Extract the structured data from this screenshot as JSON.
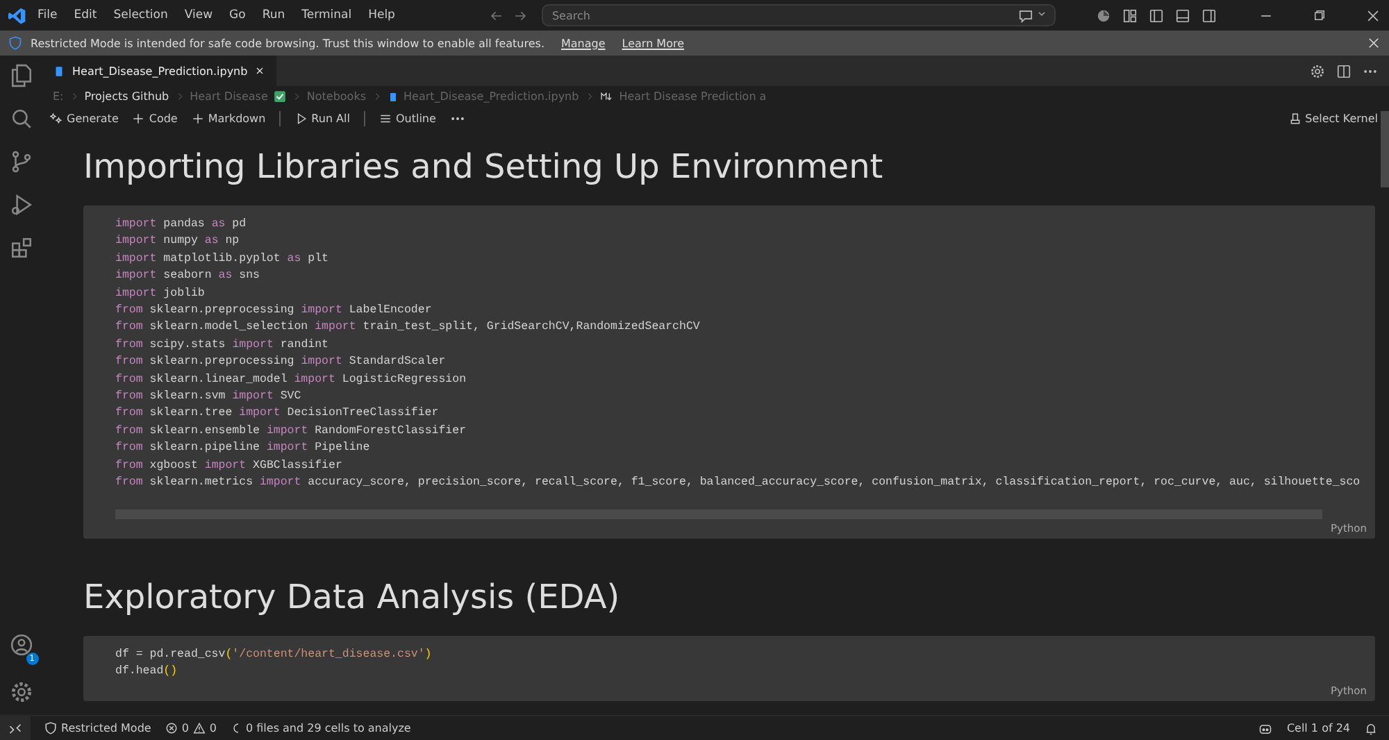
{
  "menu": [
    "File",
    "Edit",
    "Selection",
    "View",
    "Go",
    "Run",
    "Terminal",
    "Help"
  ],
  "search": {
    "placeholder": "Search"
  },
  "notice": {
    "text": "Restricted Mode is intended for safe code browsing. Trust this window to enable all features.",
    "links": [
      "Manage",
      "Learn More"
    ]
  },
  "tabs": [
    {
      "label": "Heart_Disease_Prediction.ipynb",
      "selected": true
    }
  ],
  "breadcrumbs": [
    "E:",
    "Projects Github",
    "Heart Disease",
    "Notebooks",
    "Heart_Disease_Prediction.ipynb",
    "Heart Disease Prediction a"
  ],
  "toolbar": [
    "Generate",
    "Code",
    "Markdown",
    "Run All",
    "Outline"
  ],
  "kernel": "Select Kernel",
  "account_badge": "1",
  "cells": [
    {
      "kind": "markdown",
      "heading": "Importing Libraries and Setting Up Environment"
    },
    {
      "kind": "code",
      "language": "Python",
      "lines": [
        [
          {
            "text": "import",
            "kind": "keyword"
          },
          {
            "text": " pandas ",
            "kind": "name"
          },
          {
            "text": "as",
            "kind": "keyword"
          },
          {
            "text": " pd",
            "kind": "name"
          }
        ],
        [
          {
            "text": "import",
            "kind": "keyword"
          },
          {
            "text": " numpy ",
            "kind": "name"
          },
          {
            "text": "as",
            "kind": "keyword"
          },
          {
            "text": " np",
            "kind": "name"
          }
        ],
        [
          {
            "text": "import",
            "kind": "keyword"
          },
          {
            "text": " matplotlib.pyplot ",
            "kind": "name"
          },
          {
            "text": "as",
            "kind": "keyword"
          },
          {
            "text": " plt",
            "kind": "name"
          }
        ],
        [
          {
            "text": "import",
            "kind": "keyword"
          },
          {
            "text": " seaborn ",
            "kind": "name"
          },
          {
            "text": "as",
            "kind": "keyword"
          },
          {
            "text": " sns",
            "kind": "name"
          }
        ],
        [
          {
            "text": "import",
            "kind": "keyword"
          },
          {
            "text": " joblib",
            "kind": "name"
          }
        ],
        [
          {
            "text": "from",
            "kind": "keyword"
          },
          {
            "text": " sklearn.preprocessing ",
            "kind": "name"
          },
          {
            "text": "import",
            "kind": "keyword"
          },
          {
            "text": " LabelEncoder",
            "kind": "name"
          }
        ],
        [
          {
            "text": "from",
            "kind": "keyword"
          },
          {
            "text": " sklearn.model_selection ",
            "kind": "name"
          },
          {
            "text": "import",
            "kind": "keyword"
          },
          {
            "text": " train_test_split, GridSearchCV,RandomizedSearchCV",
            "kind": "name"
          }
        ],
        [
          {
            "text": "from",
            "kind": "keyword"
          },
          {
            "text": " scipy.stats ",
            "kind": "name"
          },
          {
            "text": "import",
            "kind": "keyword"
          },
          {
            "text": " randint",
            "kind": "name"
          }
        ],
        [
          {
            "text": "from",
            "kind": "keyword"
          },
          {
            "text": " sklearn.preprocessing ",
            "kind": "name"
          },
          {
            "text": "import",
            "kind": "keyword"
          },
          {
            "text": " StandardScaler",
            "kind": "name"
          }
        ],
        [
          {
            "text": "from",
            "kind": "keyword"
          },
          {
            "text": " sklearn.linear_model ",
            "kind": "name"
          },
          {
            "text": "import",
            "kind": "keyword"
          },
          {
            "text": " LogisticRegression",
            "kind": "name"
          }
        ],
        [
          {
            "text": "from",
            "kind": "keyword"
          },
          {
            "text": " sklearn.svm ",
            "kind": "name"
          },
          {
            "text": "import",
            "kind": "keyword"
          },
          {
            "text": " SVC",
            "kind": "name"
          }
        ],
        [
          {
            "text": "from",
            "kind": "keyword"
          },
          {
            "text": " sklearn.tree ",
            "kind": "name"
          },
          {
            "text": "import",
            "kind": "keyword"
          },
          {
            "text": " DecisionTreeClassifier",
            "kind": "name"
          }
        ],
        [
          {
            "text": "from",
            "kind": "keyword"
          },
          {
            "text": " sklearn.ensemble ",
            "kind": "name"
          },
          {
            "text": "import",
            "kind": "keyword"
          },
          {
            "text": " RandomForestClassifier",
            "kind": "name"
          }
        ],
        [
          {
            "text": "from",
            "kind": "keyword"
          },
          {
            "text": " sklearn.pipeline ",
            "kind": "name"
          },
          {
            "text": "import",
            "kind": "keyword"
          },
          {
            "text": " Pipeline",
            "kind": "name"
          }
        ],
        [
          {
            "text": "from",
            "kind": "keyword"
          },
          {
            "text": " xgboost ",
            "kind": "name"
          },
          {
            "text": "import",
            "kind": "keyword"
          },
          {
            "text": " XGBClassifier",
            "kind": "name"
          }
        ],
        [
          {
            "text": "from",
            "kind": "keyword"
          },
          {
            "text": " sklearn.metrics ",
            "kind": "name"
          },
          {
            "text": "import",
            "kind": "keyword"
          },
          {
            "text": " accuracy_score, precision_score, recall_score, f1_score, balanced_accuracy_score, confusion_matrix, classification_report, roc_curve, auc, silhouette_sco",
            "kind": "name"
          }
        ]
      ]
    },
    {
      "kind": "markdown",
      "heading": "Exploratory Data Analysis (EDA)"
    },
    {
      "kind": "code",
      "language": "Python",
      "lines": [
        [
          {
            "text": "df = pd.read_csv",
            "kind": "name"
          },
          {
            "text": "(",
            "kind": "paren"
          },
          {
            "text": "'/content/heart_disease.csv'",
            "kind": "string"
          },
          {
            "text": ")",
            "kind": "paren"
          }
        ],
        [
          {
            "text": "df.head",
            "kind": "name"
          },
          {
            "text": "()",
            "kind": "paren"
          }
        ]
      ]
    }
  ],
  "status": {
    "mode": "Restricted Mode",
    "errors": "0",
    "warnings": "0",
    "analysis": "0 files and 29 cells to analyze",
    "cell": "Cell 1 of 24"
  }
}
